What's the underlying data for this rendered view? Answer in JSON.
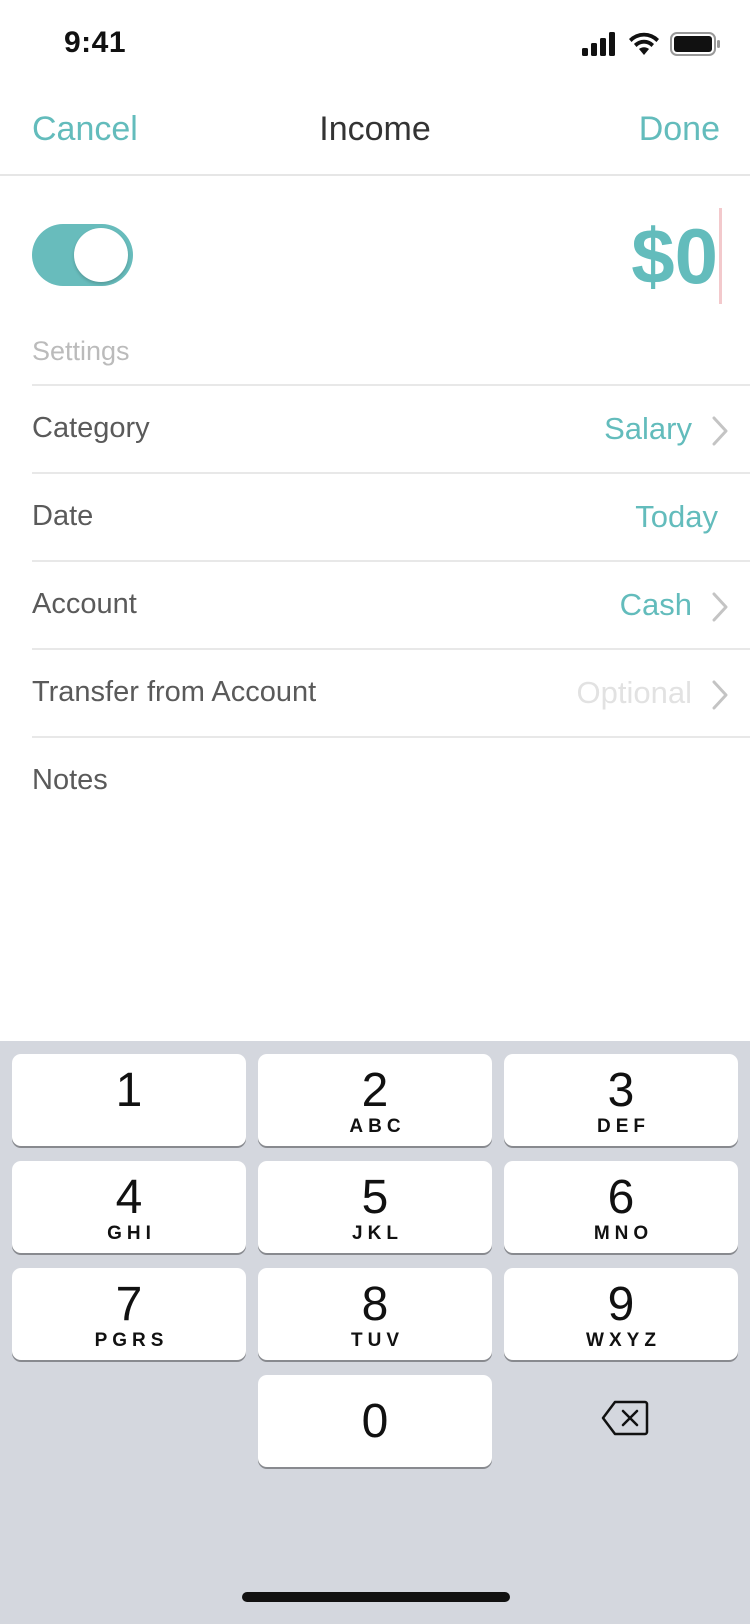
{
  "status_bar": {
    "time": "9:41",
    "icons": [
      "cellular-signal-icon",
      "wifi-icon",
      "battery-icon"
    ]
  },
  "nav": {
    "cancel_label": "Cancel",
    "title": "Income",
    "done_label": "Done"
  },
  "toggle": {
    "state": "on",
    "accent_color": "#68bcbc"
  },
  "amount": {
    "value": "$0"
  },
  "settings": {
    "section_label": "Settings",
    "rows": [
      {
        "label": "Category",
        "value": "Salary",
        "has_chevron": true
      },
      {
        "label": "Date",
        "value": "Today",
        "has_chevron": false
      },
      {
        "label": "Account",
        "value": "Cash",
        "has_chevron": true
      },
      {
        "label": "Transfer from Account",
        "value": "Optional",
        "has_chevron": true
      }
    ],
    "notes_label": "Notes"
  },
  "keyboard": {
    "keys": [
      {
        "num": "1",
        "letters": ""
      },
      {
        "num": "2",
        "letters": "ABC"
      },
      {
        "num": "3",
        "letters": "DEF"
      },
      {
        "num": "4",
        "letters": "GHI"
      },
      {
        "num": "5",
        "letters": "JKL"
      },
      {
        "num": "6",
        "letters": "MNO"
      },
      {
        "num": "7",
        "letters": "PGRS"
      },
      {
        "num": "8",
        "letters": "TUV"
      },
      {
        "num": "9",
        "letters": "WXYZ"
      },
      {
        "num": "0",
        "letters": ""
      }
    ],
    "backspace_icon": "backspace-icon"
  },
  "colors": {
    "accent": "#63bcbc",
    "keyboard_bg": "#d4d7de",
    "divider": "#e8e8e8"
  }
}
